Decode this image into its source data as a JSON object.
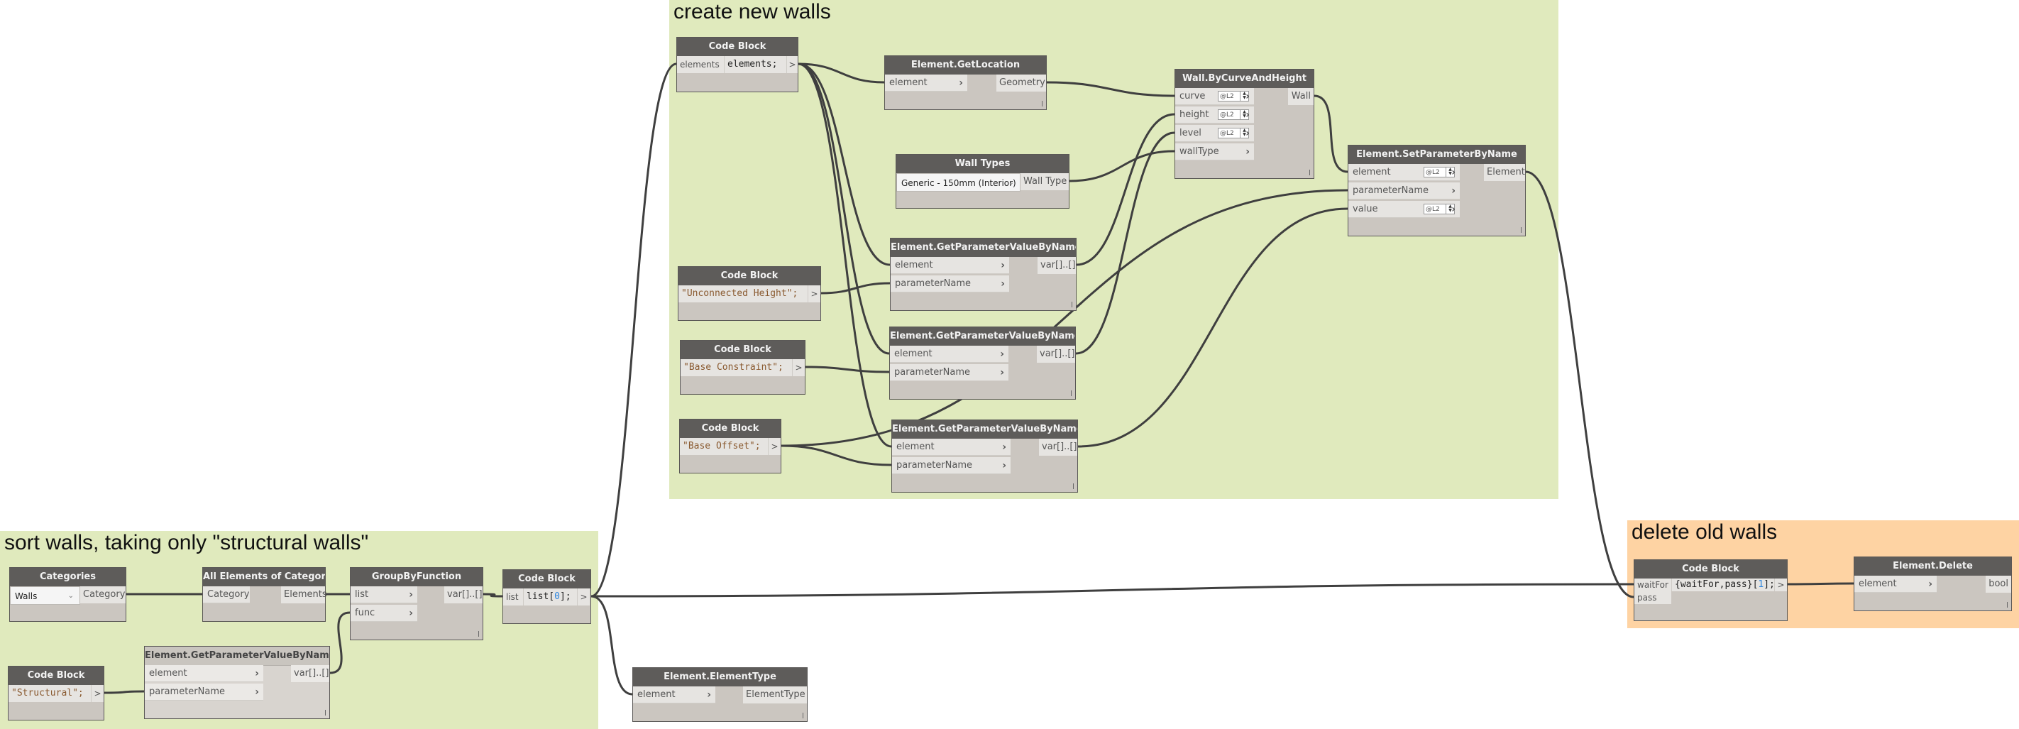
{
  "groups": {
    "create": {
      "title": "create new walls",
      "color": "#e0eabd"
    },
    "sort": {
      "title": "sort walls, taking only \"structural walls\"",
      "color": "#e0eabd"
    },
    "delete": {
      "title": "delete old walls",
      "color": "#fed3a3"
    }
  },
  "nodes": {
    "cb_elements": {
      "title": "Code Block",
      "input": "elements",
      "code": "elements;",
      "out": ">"
    },
    "get_location": {
      "title": "Element.GetLocation",
      "input": "element",
      "output": "Geometry"
    },
    "wall_types": {
      "title": "Wall Types",
      "selected": "Generic - 150mm (Interior)",
      "output": "Wall Type"
    },
    "wall_by_curve": {
      "title": "Wall.ByCurveAndHeight",
      "inputs": [
        "curve",
        "height",
        "level",
        "wallType"
      ],
      "lacing": "@L2",
      "output": "Wall"
    },
    "set_param": {
      "title": "Element.SetParameterByName",
      "inputs": [
        "element",
        "parameterName",
        "value"
      ],
      "lacing": "@L2",
      "output": "Element"
    },
    "cb_unconnected": {
      "title": "Code Block",
      "code": "\"Unconnected Height\";",
      "out": ">"
    },
    "cb_constraint": {
      "title": "Code Block",
      "code": "\"Base Constraint\";",
      "out": ">"
    },
    "cb_offset": {
      "title": "Code Block",
      "code": "\"Base Offset\";",
      "out": ">"
    },
    "gpv1": {
      "title": "Element.GetParameterValueByName",
      "inputs": [
        "element",
        "parameterName"
      ],
      "output": "var[]..[]"
    },
    "gpv2": {
      "title": "Element.GetParameterValueByName",
      "inputs": [
        "element",
        "parameterName"
      ],
      "output": "var[]..[]"
    },
    "gpv3": {
      "title": "Element.GetParameterValueByName",
      "inputs": [
        "element",
        "parameterName"
      ],
      "output": "var[]..[]"
    },
    "categories": {
      "title": "Categories",
      "selected": "Walls",
      "output": "Category"
    },
    "all_elements": {
      "title": "All Elements of Category",
      "input": "Category",
      "output": "Elements"
    },
    "group_by": {
      "title": "GroupByFunction",
      "inputs": [
        "list",
        "func"
      ],
      "output": "var[]..[]"
    },
    "cb_list": {
      "title": "Code Block",
      "input": "list",
      "code_prefix": "list[",
      "code_index": "0",
      "code_suffix": "];",
      "out": ">"
    },
    "cb_structural": {
      "title": "Code Block",
      "code": "\"Structural\";",
      "out": ">"
    },
    "gpv_sort": {
      "title": "Element.GetParameterValueByName",
      "inputs": [
        "element",
        "parameterName"
      ],
      "output": "var[]..[]"
    },
    "element_type": {
      "title": "Element.ElementType",
      "input": "element",
      "output": "ElementType"
    },
    "cb_delete": {
      "title": "Code Block",
      "inputs": [
        "waitFor",
        "pass"
      ],
      "code_prefix": "{waitFor,pass}[",
      "code_index": "1",
      "code_suffix": "];",
      "out": ">"
    },
    "element_delete": {
      "title": "Element.Delete",
      "input": "element",
      "output": "bool"
    }
  },
  "connections": [
    {
      "from": "categories.out",
      "to": "all_elements.in0"
    },
    {
      "from": "all_elements.out",
      "to": "group_by.in0"
    },
    {
      "from": "gpv_sort.out",
      "to": "group_by.in1"
    },
    {
      "from": "cb_structural.out",
      "to": "gpv_sort.in1"
    },
    {
      "from": "group_by.out",
      "to": "cb_list.in0"
    },
    {
      "from": "cb_list.out",
      "to": "cb_elements.in0"
    },
    {
      "from": "cb_list.out",
      "to": "element_type.in0"
    },
    {
      "from": "cb_list.out",
      "to": "cb_delete.in0"
    },
    {
      "from": "cb_elements.out",
      "to": "get_location.in0"
    },
    {
      "from": "cb_elements.out",
      "to": "gpv1.in0"
    },
    {
      "from": "cb_elements.out",
      "to": "gpv2.in0"
    },
    {
      "from": "cb_elements.out",
      "to": "gpv3.in0"
    },
    {
      "from": "cb_unconnected.out",
      "to": "gpv1.in1"
    },
    {
      "from": "cb_constraint.out",
      "to": "gpv2.in1"
    },
    {
      "from": "cb_offset.out",
      "to": "gpv3.in1"
    },
    {
      "from": "cb_offset.out",
      "to": "set_param.in1"
    },
    {
      "from": "get_location.out",
      "to": "wall_by_curve.in0"
    },
    {
      "from": "gpv1.out",
      "to": "wall_by_curve.in1"
    },
    {
      "from": "gpv2.out",
      "to": "wall_by_curve.in2"
    },
    {
      "from": "wall_types.out",
      "to": "wall_by_curve.in3"
    },
    {
      "from": "wall_by_curve.out",
      "to": "set_param.in0"
    },
    {
      "from": "gpv3.out",
      "to": "set_param.in2"
    },
    {
      "from": "set_param.out",
      "to": "cb_delete.in1"
    },
    {
      "from": "cb_delete.out",
      "to": "element_delete.in0"
    }
  ]
}
